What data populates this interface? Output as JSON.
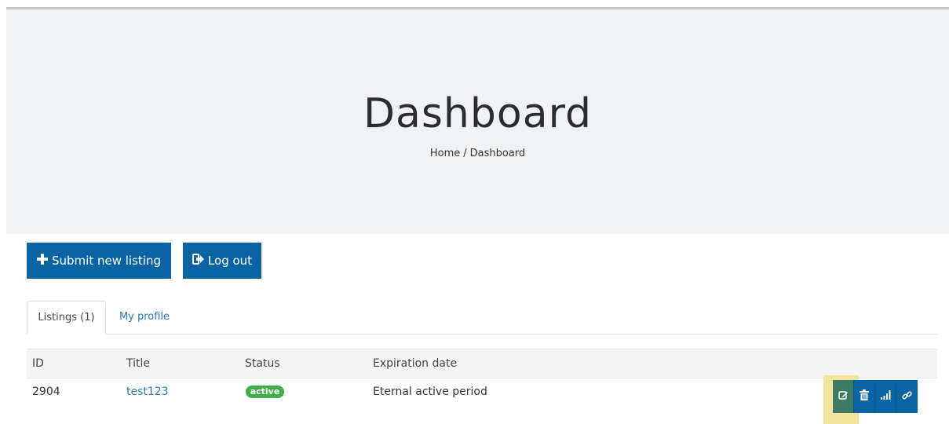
{
  "hero": {
    "title": "Dashboard",
    "breadcrumb": {
      "home": "Home",
      "separator": "/",
      "current": "Dashboard"
    }
  },
  "buttons": {
    "submit": {
      "icon": "plus-icon",
      "label": "Submit new listing"
    },
    "logout": {
      "icon": "logout-icon",
      "label": "Log out"
    }
  },
  "tabs": [
    {
      "label": "Listings (1)",
      "active": true
    },
    {
      "label": "My profile",
      "active": false
    }
  ],
  "table": {
    "headers": [
      "ID",
      "Title",
      "Status",
      "Expiration date"
    ],
    "rows": [
      {
        "id": "2904",
        "title": "test123",
        "status": "active",
        "expiration": "Eternal active period"
      }
    ],
    "actions": [
      "edit-icon",
      "delete-icon",
      "stats-icon",
      "link-icon"
    ]
  },
  "colors": {
    "primary": "#0a63a3",
    "hero_bg": "#f1f2f4",
    "status_active": "#3fae49",
    "edit_button": "#3d7a63",
    "highlight": "#f4e39a"
  }
}
